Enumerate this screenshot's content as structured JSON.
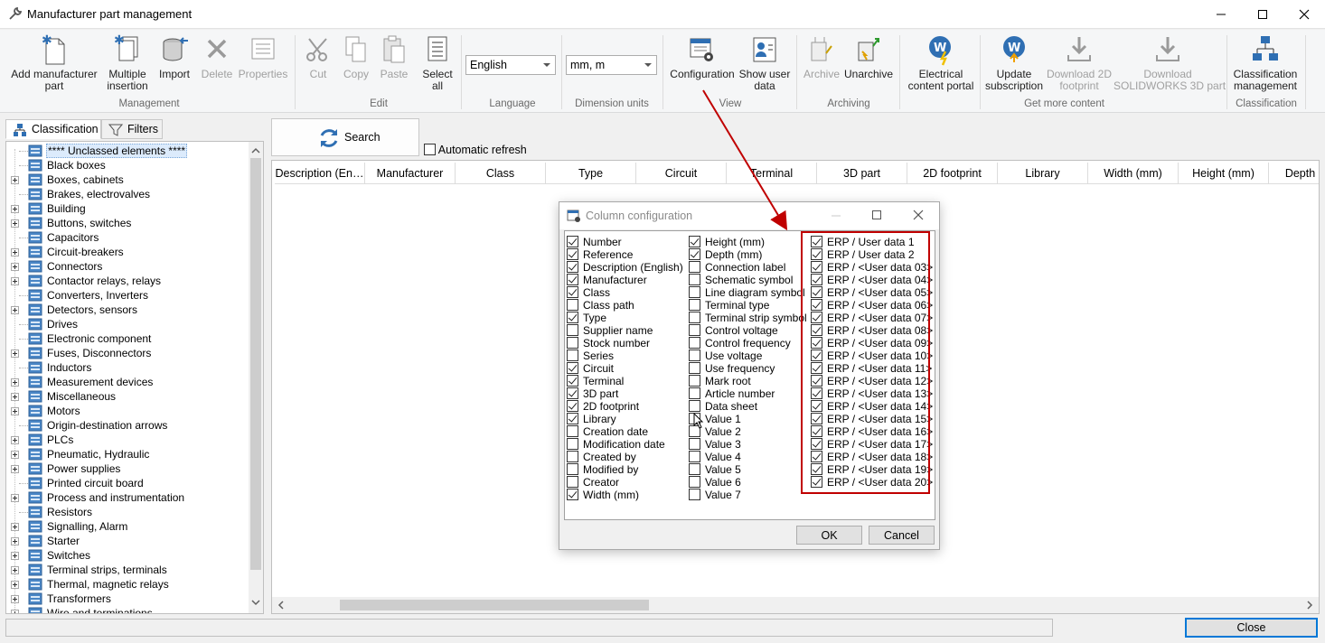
{
  "window": {
    "title": "Manufacturer part management"
  },
  "ribbon": {
    "buttons": {
      "add_manufacturer_part": "Add manufacturer\npart",
      "multiple_insertion": "Multiple\ninsertion",
      "import": "Import",
      "delete": "Delete",
      "properties": "Properties",
      "cut": "Cut",
      "copy": "Copy",
      "paste": "Paste",
      "select_all": "Select\nall",
      "configuration": "Configuration",
      "show_user_data": "Show user\ndata",
      "archive": "Archive",
      "unarchive": "Unarchive",
      "electrical_content_portal": "Electrical\ncontent portal",
      "update_subscription": "Update\nsubscription",
      "download_2d_footprint": "Download 2D\nfootprint",
      "download_solidworks_3d_part": "Download\nSOLIDWORKS 3D part",
      "classification_management": "Classification\nmanagement"
    },
    "groups": {
      "management": "Management",
      "edit": "Edit",
      "language": "Language",
      "dimension_units": "Dimension units",
      "view": "View",
      "archiving": "Archiving",
      "get_more_content": "Get more content",
      "classification": "Classification"
    },
    "language_value": "English",
    "units_value": "mm, m"
  },
  "left_panel": {
    "tabs": {
      "classification": "Classification",
      "filters": "Filters"
    },
    "tree": [
      {
        "label": "**** Unclassed elements ****",
        "expandable": false,
        "selected": true
      },
      {
        "label": "Black boxes",
        "expandable": false
      },
      {
        "label": "Boxes, cabinets",
        "expandable": true
      },
      {
        "label": "Brakes, electrovalves",
        "expandable": false
      },
      {
        "label": "Building",
        "expandable": true
      },
      {
        "label": "Buttons, switches",
        "expandable": true
      },
      {
        "label": "Capacitors",
        "expandable": false
      },
      {
        "label": "Circuit-breakers",
        "expandable": true
      },
      {
        "label": "Connectors",
        "expandable": true
      },
      {
        "label": "Contactor relays, relays",
        "expandable": true
      },
      {
        "label": "Converters, Inverters",
        "expandable": false
      },
      {
        "label": "Detectors, sensors",
        "expandable": true
      },
      {
        "label": "Drives",
        "expandable": false
      },
      {
        "label": "Electronic component",
        "expandable": false
      },
      {
        "label": "Fuses, Disconnectors",
        "expandable": true
      },
      {
        "label": "Inductors",
        "expandable": false
      },
      {
        "label": "Measurement devices",
        "expandable": true
      },
      {
        "label": "Miscellaneous",
        "expandable": true
      },
      {
        "label": "Motors",
        "expandable": true
      },
      {
        "label": "Origin-destination arrows",
        "expandable": false
      },
      {
        "label": "PLCs",
        "expandable": true
      },
      {
        "label": "Pneumatic, Hydraulic",
        "expandable": true
      },
      {
        "label": "Power supplies",
        "expandable": true
      },
      {
        "label": "Printed circuit board",
        "expandable": false
      },
      {
        "label": "Process and instrumentation",
        "expandable": true
      },
      {
        "label": "Resistors",
        "expandable": false
      },
      {
        "label": "Signalling, Alarm",
        "expandable": true
      },
      {
        "label": "Starter",
        "expandable": true
      },
      {
        "label": "Switches",
        "expandable": true
      },
      {
        "label": "Terminal strips, terminals",
        "expandable": true
      },
      {
        "label": "Thermal, magnetic relays",
        "expandable": true
      },
      {
        "label": "Transformers",
        "expandable": true
      },
      {
        "label": "Wire and terminations",
        "expandable": true
      }
    ]
  },
  "search": {
    "button": "Search",
    "auto_refresh": "Automatic refresh",
    "auto_refresh_checked": false
  },
  "grid": {
    "columns": [
      "Description (En…",
      "Manufacturer",
      "Class",
      "Type",
      "Circuit",
      "Terminal",
      "3D part",
      "2D footprint",
      "Library",
      "Width (mm)",
      "Height (mm)",
      "Depth"
    ]
  },
  "dialog": {
    "title": "Column configuration",
    "ok": "OK",
    "cancel": "Cancel",
    "column1": [
      {
        "label": "Number",
        "checked": true
      },
      {
        "label": "Reference",
        "checked": true
      },
      {
        "label": "Description (English)",
        "checked": true
      },
      {
        "label": "Manufacturer",
        "checked": true
      },
      {
        "label": "Class",
        "checked": true
      },
      {
        "label": "Class path",
        "checked": false
      },
      {
        "label": "Type",
        "checked": true
      },
      {
        "label": "Supplier name",
        "checked": false
      },
      {
        "label": "Stock number",
        "checked": false
      },
      {
        "label": "Series",
        "checked": false
      },
      {
        "label": "Circuit",
        "checked": true
      },
      {
        "label": "Terminal",
        "checked": true
      },
      {
        "label": "3D part",
        "checked": true
      },
      {
        "label": "2D footprint",
        "checked": true
      },
      {
        "label": "Library",
        "checked": true
      },
      {
        "label": "Creation date",
        "checked": false
      },
      {
        "label": "Modification date",
        "checked": false
      },
      {
        "label": "Created by",
        "checked": false
      },
      {
        "label": "Modified by",
        "checked": false
      },
      {
        "label": "Creator",
        "checked": false
      },
      {
        "label": "Width (mm)",
        "checked": true
      }
    ],
    "column2": [
      {
        "label": "Height (mm)",
        "checked": true
      },
      {
        "label": "Depth (mm)",
        "checked": true
      },
      {
        "label": "Connection label",
        "checked": false
      },
      {
        "label": "Schematic symbol",
        "checked": false
      },
      {
        "label": "Line diagram symbol",
        "checked": false
      },
      {
        "label": "Terminal type",
        "checked": false
      },
      {
        "label": "Terminal strip symbol",
        "checked": false
      },
      {
        "label": "Control voltage",
        "checked": false
      },
      {
        "label": "Control frequency",
        "checked": false
      },
      {
        "label": "Use voltage",
        "checked": false
      },
      {
        "label": "Use frequency",
        "checked": false
      },
      {
        "label": "Mark root",
        "checked": false
      },
      {
        "label": "Article number",
        "checked": false
      },
      {
        "label": "Data sheet",
        "checked": false
      },
      {
        "label": "Value 1",
        "checked": false
      },
      {
        "label": "Value 2",
        "checked": false
      },
      {
        "label": "Value 3",
        "checked": false
      },
      {
        "label": "Value 4",
        "checked": false
      },
      {
        "label": "Value 5",
        "checked": false
      },
      {
        "label": "Value 6",
        "checked": false
      },
      {
        "label": "Value 7",
        "checked": false
      }
    ],
    "column3": [
      {
        "label": "ERP / User data 1",
        "checked": true
      },
      {
        "label": "ERP / User data 2",
        "checked": true
      },
      {
        "label": "ERP / <User data 03>",
        "checked": true
      },
      {
        "label": "ERP / <User data 04>",
        "checked": true
      },
      {
        "label": "ERP / <User data 05>",
        "checked": true
      },
      {
        "label": "ERP / <User data 06>",
        "checked": true
      },
      {
        "label": "ERP / <User data 07>",
        "checked": true
      },
      {
        "label": "ERP / <User data 08>",
        "checked": true
      },
      {
        "label": "ERP / <User data 09>",
        "checked": true
      },
      {
        "label": "ERP / <User data 10>",
        "checked": true
      },
      {
        "label": "ERP / <User data 11>",
        "checked": true
      },
      {
        "label": "ERP / <User data 12>",
        "checked": true
      },
      {
        "label": "ERP / <User data 13>",
        "checked": true
      },
      {
        "label": "ERP / <User data 14>",
        "checked": true
      },
      {
        "label": "ERP / <User data 15>",
        "checked": true
      },
      {
        "label": "ERP / <User data 16>",
        "checked": true
      },
      {
        "label": "ERP / <User data 17>",
        "checked": true
      },
      {
        "label": "ERP / <User data 18>",
        "checked": true
      },
      {
        "label": "ERP / <User data 19>",
        "checked": true
      },
      {
        "label": "ERP / <User data 20>",
        "checked": true
      }
    ]
  },
  "footer": {
    "close": "Close"
  },
  "colors": {
    "annotation_red": "#c00000",
    "selection_blue": "#0078d7",
    "icon_blue": "#2f6fb3"
  }
}
